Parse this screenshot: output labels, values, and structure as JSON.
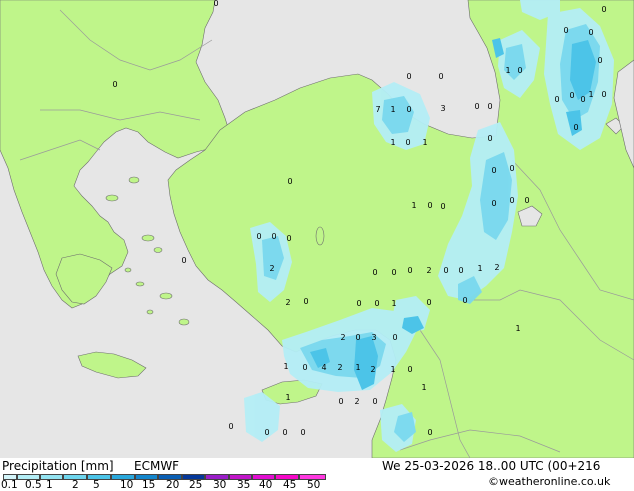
{
  "footer": {
    "title": "Precipitation [mm]",
    "model": "ECMWF",
    "datetime": "We 25-03-2026 18..00 UTC (00+216",
    "credit": "©weatheronline.co.uk"
  },
  "colorbar": {
    "labels": [
      "0.1",
      "0.5",
      "1",
      "2",
      "5",
      "10",
      "15",
      "20",
      "25",
      "30",
      "35",
      "40",
      "45",
      "50"
    ],
    "colors": [
      "#d4f5fa",
      "#b4eef6",
      "#94e4f2",
      "#6ed6ee",
      "#4cc4e8",
      "#2aa8dc",
      "#1486cc",
      "#0a5fb4",
      "#05389a",
      "#9a1ec8",
      "#c016c8",
      "#e00ed0",
      "#f508c8",
      "#ff38e0"
    ]
  },
  "colors": {
    "land": "#bff58a",
    "sea_outside": "#e6e6e6",
    "light_rain": "#b4eef6",
    "moderate_rain": "#7ad8ee",
    "heavy_rain": "#4cc4e8",
    "coast": "#6e6e6e",
    "border": "#9a9a9a"
  },
  "labels": [
    {
      "t": "0"
    },
    {
      "t": "0"
    },
    {
      "t": "0"
    },
    {
      "t": "0"
    },
    {
      "t": "0"
    },
    {
      "t": "0"
    },
    {
      "t": "0"
    },
    {
      "t": "0"
    },
    {
      "t": "1"
    },
    {
      "t": "0"
    },
    {
      "t": "1"
    },
    {
      "t": "0"
    },
    {
      "t": "0"
    },
    {
      "t": "0"
    },
    {
      "t": "0"
    },
    {
      "t": "0"
    },
    {
      "t": "7"
    },
    {
      "t": "1"
    },
    {
      "t": "0"
    },
    {
      "t": "3"
    },
    {
      "t": "0"
    },
    {
      "t": "0"
    },
    {
      "t": "0"
    },
    {
      "t": "0"
    },
    {
      "t": "1"
    },
    {
      "t": "1"
    },
    {
      "t": "0"
    },
    {
      "t": "0"
    },
    {
      "t": "0"
    },
    {
      "t": "1"
    },
    {
      "t": "0"
    },
    {
      "t": "0"
    },
    {
      "t": "0"
    },
    {
      "t": "0"
    },
    {
      "t": "0"
    },
    {
      "t": "2"
    },
    {
      "t": "0"
    },
    {
      "t": "0"
    },
    {
      "t": "0"
    },
    {
      "t": "0"
    },
    {
      "t": "0"
    },
    {
      "t": "0"
    },
    {
      "t": "0"
    },
    {
      "t": "2"
    },
    {
      "t": "0"
    },
    {
      "t": "0"
    },
    {
      "t": "1"
    },
    {
      "t": "2"
    },
    {
      "t": "0"
    },
    {
      "t": "0"
    },
    {
      "t": "2"
    },
    {
      "t": "0"
    },
    {
      "t": "0"
    },
    {
      "t": "1"
    },
    {
      "t": "0"
    },
    {
      "t": "1"
    },
    {
      "t": "2"
    },
    {
      "t": "0"
    },
    {
      "t": "3"
    },
    {
      "t": "0"
    },
    {
      "t": "1"
    },
    {
      "t": "0"
    },
    {
      "t": "4"
    },
    {
      "t": "2"
    },
    {
      "t": "1"
    },
    {
      "t": "2"
    },
    {
      "t": "1"
    },
    {
      "t": "0"
    },
    {
      "t": "1"
    },
    {
      "t": "1"
    },
    {
      "t": "0"
    },
    {
      "t": "2"
    },
    {
      "t": "0"
    },
    {
      "t": "0"
    },
    {
      "t": "0"
    },
    {
      "t": "0"
    },
    {
      "t": "0"
    },
    {
      "t": "0"
    }
  ]
}
